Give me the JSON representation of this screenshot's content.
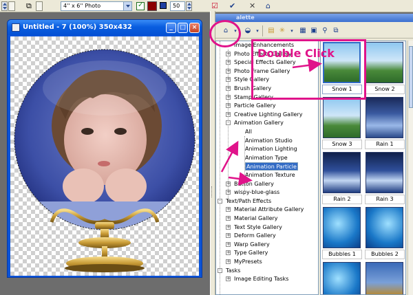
{
  "toolbar": {
    "size_preset": "4'' x 6'' Photo",
    "number_value": "50",
    "color_swatch": "#8b0000",
    "apply_icon": "checkmark-icon",
    "cancel_icon": "x-icon",
    "home_icon": "house-icon"
  },
  "image_window": {
    "title": "Untitled - 7 (100%) 350x432",
    "buttons": [
      "_",
      "□",
      "×"
    ]
  },
  "palette": {
    "title": "Palette",
    "title_visible": "alette",
    "tree": [
      {
        "label": "Image Enhancements",
        "expander": "",
        "level": 1
      },
      {
        "label": "Photo Effects Gallery",
        "expander": "+",
        "level": 1
      },
      {
        "label": "Special Effects Gallery",
        "expander": "+",
        "level": 1
      },
      {
        "label": "Photo Frame Gallery",
        "expander": "+",
        "level": 1
      },
      {
        "label": "Style Gallery",
        "expander": "+",
        "level": 1
      },
      {
        "label": "Brush Gallery",
        "expander": "+",
        "level": 1
      },
      {
        "label": "Stamp Gallery",
        "expander": "+",
        "level": 1
      },
      {
        "label": "Particle Gallery",
        "expander": "+",
        "level": 1
      },
      {
        "label": "Creative Lighting Gallery",
        "expander": "+",
        "level": 1
      },
      {
        "label": "Animation Gallery",
        "expander": "-",
        "level": 1
      },
      {
        "label": "All",
        "expander": "",
        "level": 2
      },
      {
        "label": "Animation Studio",
        "expander": "",
        "level": 2
      },
      {
        "label": "Animation Lighting",
        "expander": "",
        "level": 2
      },
      {
        "label": "Animation Type",
        "expander": "",
        "level": 2
      },
      {
        "label": "Animation Particle",
        "expander": "",
        "level": 2,
        "selected": true
      },
      {
        "label": "Animation Texture",
        "expander": "",
        "level": 2
      },
      {
        "label": "Button Gallery",
        "expander": "+",
        "level": 1
      },
      {
        "label": "wispy-blue-glass",
        "expander": "+",
        "level": 1
      },
      {
        "label": "Text/Path Effects",
        "expander": "-",
        "level": 0
      },
      {
        "label": "Material Attribute Gallery",
        "expander": "+",
        "level": 1
      },
      {
        "label": "Material Gallery",
        "expander": "+",
        "level": 1
      },
      {
        "label": "Text Style Gallery",
        "expander": "+",
        "level": 1
      },
      {
        "label": "Deform Gallery",
        "expander": "+",
        "level": 1
      },
      {
        "label": "Warp Gallery",
        "expander": "+",
        "level": 1
      },
      {
        "label": "Type Gallery",
        "expander": "+",
        "level": 1
      },
      {
        "label": "MyPresets",
        "expander": "+",
        "level": 1
      },
      {
        "label": "Tasks",
        "expander": "-",
        "level": 0
      },
      {
        "label": "Image Editing Tasks",
        "expander": "+",
        "level": 1
      }
    ],
    "thumbnails": [
      {
        "label": "Snow 1",
        "selected": true
      },
      {
        "label": "Snow 2",
        "selected": false
      },
      {
        "label": "Snow 3",
        "selected": false
      },
      {
        "label": "Rain 1",
        "selected": false
      },
      {
        "label": "Rain 2",
        "selected": false
      },
      {
        "label": "Rain 3",
        "selected": false
      },
      {
        "label": "Bubbles 1",
        "selected": false
      },
      {
        "label": "Bubbles 2",
        "selected": false
      },
      {
        "label": "",
        "selected": false
      },
      {
        "label": "",
        "selected": false
      }
    ]
  },
  "annotation": {
    "text": "Double Click",
    "color": "#e0138a"
  }
}
